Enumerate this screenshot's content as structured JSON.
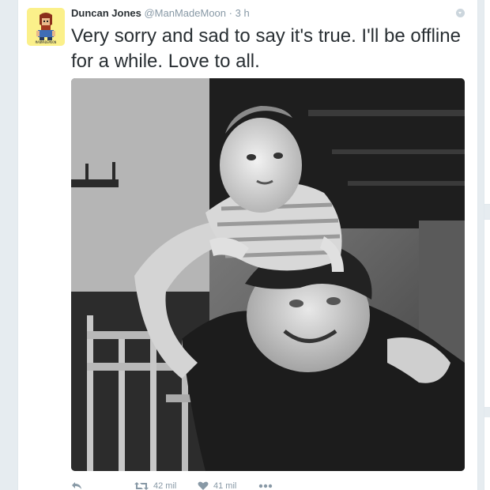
{
  "tweet": {
    "author": {
      "display_name": "Duncan Jones",
      "handle": "@ManMadeMoon",
      "avatar_caption": "MANMADEMOON"
    },
    "separator": "·",
    "time": "3 h",
    "text": "Very sorry and sad to say it's true.  I'll be offline for a while.  Love to all.",
    "media": {
      "type": "black-and-white photo"
    },
    "actions": {
      "reply_icon": "reply-icon",
      "retweet_icon": "retweet-icon",
      "retweet_count": "42 mil",
      "like_icon": "heart-icon",
      "like_count": "41 mil",
      "more_icon": "more-icon"
    }
  },
  "colors": {
    "background": "#e6ecf0",
    "card": "#ffffff",
    "text": "#292f33",
    "secondary_text": "#8899a6",
    "avatar_bg": "#fbf08a"
  }
}
